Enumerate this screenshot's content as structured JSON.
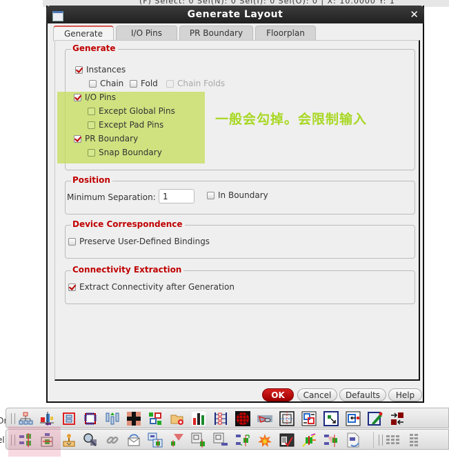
{
  "background": {
    "status_text": "(F) Select: 0   Sel(N): 0   Sel(I): 0   Sel(O): 0  |  X: 10.0000   Y: 1"
  },
  "dialog": {
    "title": "Generate Layout",
    "close_icon": "close-icon",
    "tabs": [
      {
        "label": "Generate",
        "active": true
      },
      {
        "label": "I/O Pins",
        "active": false
      },
      {
        "label": "PR Boundary",
        "active": false
      },
      {
        "label": "Floorplan",
        "active": false
      }
    ],
    "generate": {
      "title": "Generate",
      "instances": {
        "label": "Instances",
        "checked": true
      },
      "chain": {
        "label": "Chain",
        "checked": false
      },
      "fold": {
        "label": "Fold",
        "checked": false
      },
      "chain_folds": {
        "label": "Chain Folds",
        "checked": false,
        "disabled": true
      },
      "io_pins": {
        "label": "I/O Pins",
        "checked": true
      },
      "except_global_pins": {
        "label": "Except Global Pins",
        "checked": false
      },
      "except_pad_pins": {
        "label": "Except Pad Pins",
        "checked": false
      },
      "pr_boundary": {
        "label": "PR Boundary",
        "checked": true
      },
      "snap_boundary": {
        "label": "Snap Boundary",
        "checked": false
      }
    },
    "position": {
      "title": "Position",
      "min_separation_label": "Minimum Separation:",
      "min_separation_value": "1",
      "in_boundary": {
        "label": "In Boundary",
        "checked": false
      }
    },
    "device_correspondence": {
      "title": "Device Correspondence",
      "preserve_bindings": {
        "label": "Preserve User-Defined Bindings",
        "checked": false
      }
    },
    "connectivity_extraction": {
      "title": "Connectivity Extraction",
      "extract_connectivity": {
        "label": "Extract Connectivity after Generation",
        "checked": true
      }
    },
    "buttons": {
      "ok": "OK",
      "cancel": "Cancel",
      "defaults": "Defaults",
      "help": "Help"
    }
  },
  "annotation": {
    "text": "一般会勾掉。会限制输入",
    "highlight_color": "#c4de5a",
    "text_color": "#a8d824"
  },
  "colors": {
    "accent_red": "#c00000",
    "titlebar": "#2a2a2a"
  },
  "left_edge_text": [
    "Or",
    "el"
  ],
  "toolbar_top": {
    "icons": [
      "hierarchy-tree-icon",
      "align-cells-icon",
      "group-icon",
      "pad-ring-icon",
      "pin-up-icon",
      "quadrant-icon",
      "placement-icon",
      "open-folder-icon",
      "bar-chart-icon",
      "ladder-icon",
      "globe-grid-icon",
      "view-eye-icon",
      "crosshair-box-icon",
      "swap-box-icon",
      "move-corner-icon",
      "move-left-icon",
      "edit-pencil-icon",
      "exchange-arrows-icon"
    ]
  },
  "toolbar_bottom": {
    "icons": [
      "connect-pins-icon",
      "generate-from-source-icon",
      "pin-upload-icon",
      "inspect-magnifier-icon",
      "chain-link-icon",
      "envelope-update-icon",
      "layered-instances-icon",
      "check-marker-icon",
      "instance-pin-icon",
      "instance-pin-2-icon",
      "swap-components-icon",
      "explosion-icon",
      "checklist-window-icon",
      "probe-icon",
      "connect-update-icon",
      "document-update-icon",
      "table-grid-icon",
      "table-grid-2-icon"
    ]
  }
}
